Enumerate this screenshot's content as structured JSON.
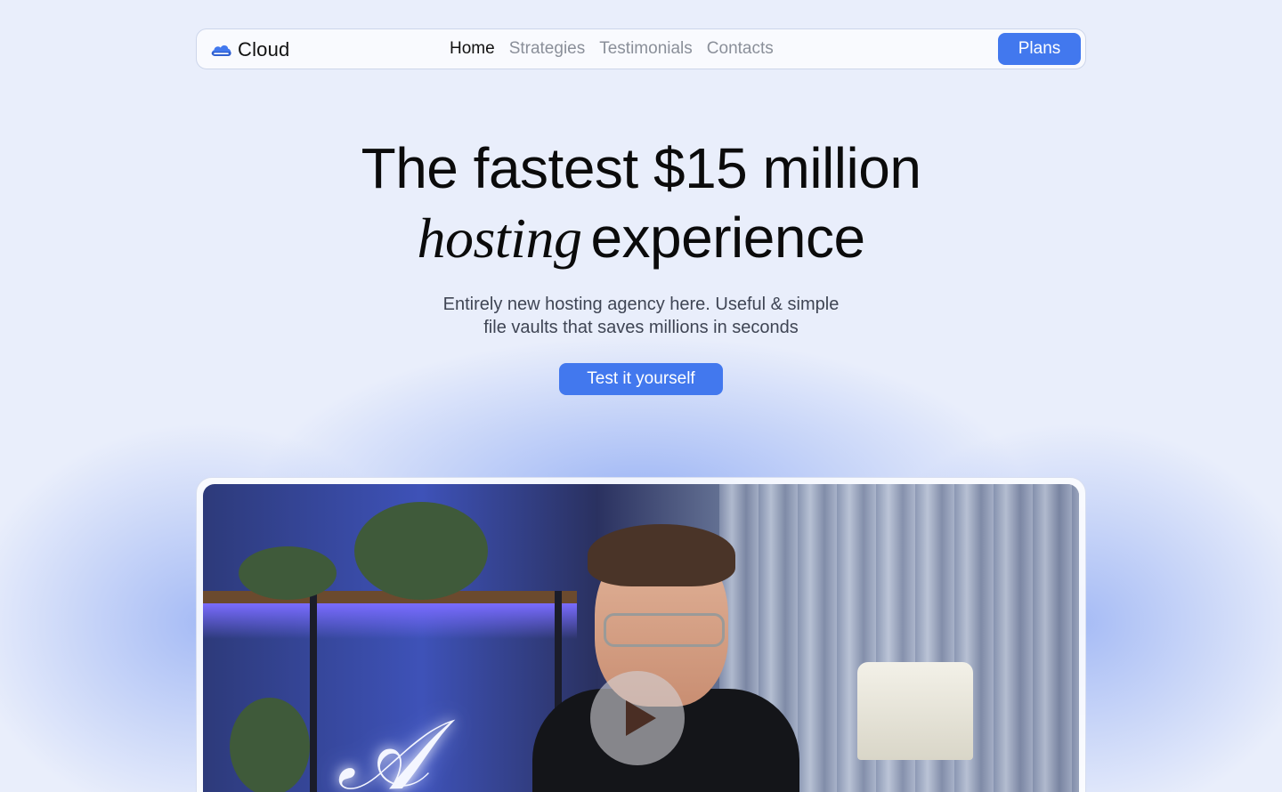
{
  "brand": {
    "name": "Cloud",
    "accent": "#4278ee",
    "logo_icon": "cloud-icon"
  },
  "nav": {
    "links": [
      "Home",
      "Strategies",
      "Testimonials",
      "Contacts"
    ],
    "active": "Home",
    "plans_label": "Plans"
  },
  "hero": {
    "headline_line1": "The fastest $15 million",
    "headline_italic": "hosting",
    "headline_rest": "experience",
    "subtitle_line1": "Entirely new hosting agency here. Useful & simple",
    "subtitle_line2": "file vaults that saves millions in seconds",
    "cta_label": "Test it yourself"
  },
  "video": {
    "play_icon": "play-icon"
  }
}
